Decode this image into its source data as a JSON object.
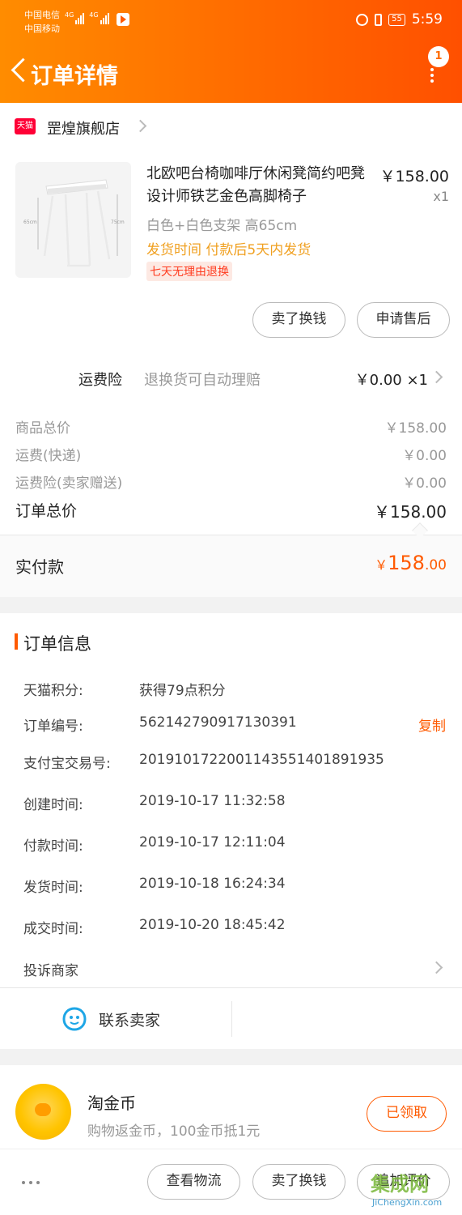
{
  "status_bar": {
    "carrier1": "中国电信",
    "carrier2": "中国移动",
    "sig_label1": "4G",
    "sig_label2": "4G",
    "battery": "55",
    "time": "5:59"
  },
  "header": {
    "title": "订单详情",
    "badge_count": "1",
    "gradient_colors": [
      "#ff8c00",
      "#ff5000"
    ]
  },
  "store": {
    "logo_text": "天猫",
    "name": "罡煌旗舰店"
  },
  "product": {
    "title": "北欧吧台椅咖啡厅休闲凳简约吧凳设计师铁艺金色高脚椅子",
    "price": "￥158.00",
    "qty": "x1",
    "sku": "白色+白色支架 高65cm",
    "ship": "发货时间 付款后5天内发货",
    "tag": "七天无理由退换",
    "dim_left": "65cm",
    "dim_right": "75cm",
    "actions": [
      "卖了换钱",
      "申请售后"
    ]
  },
  "insurance": {
    "label": "运费险",
    "desc": "退换货可自动理赔",
    "value": "￥0.00 ×1"
  },
  "prices": {
    "rows": [
      {
        "label": "商品总价",
        "value": "￥158.00"
      },
      {
        "label": "运费(快递)",
        "value": "￥0.00"
      },
      {
        "label": "运费险(卖家赠送)",
        "value": "￥0.00"
      }
    ],
    "total_label": "订单总价",
    "total_value": "￥158.00",
    "paid_label": "实付款",
    "paid_currency": "￥",
    "paid_int": "158",
    "paid_dec": ".00",
    "accent": "#ff5a00"
  },
  "order_info": {
    "title": "订单信息",
    "rows": [
      {
        "label": "天猫积分:",
        "value": "获得79点积分"
      },
      {
        "label": "订单编号:",
        "value": "562142790917130391"
      },
      {
        "label": "支付宝交易号:",
        "value": "2019101722001143551401891935"
      },
      {
        "label": "创建时间:",
        "value": "2019-10-17 11:32:58"
      },
      {
        "label": "付款时间:",
        "value": "2019-10-17 12:11:04"
      },
      {
        "label": "发货时间:",
        "value": "2019-10-18 16:24:34"
      },
      {
        "label": "成交时间:",
        "value": "2019-10-20 18:45:42"
      }
    ],
    "copy_label": "复制",
    "complaint_label": "投诉商家",
    "contact_label": "联系卖家"
  },
  "coins": {
    "title": "淘金币",
    "desc": "购物返金币，100金币抵1元",
    "button": "已领取"
  },
  "bottom_actions": [
    "查看物流",
    "卖了换钱",
    "追加评价"
  ],
  "watermark": {
    "main": "集成网",
    "sub": "JiChengXin.com"
  }
}
